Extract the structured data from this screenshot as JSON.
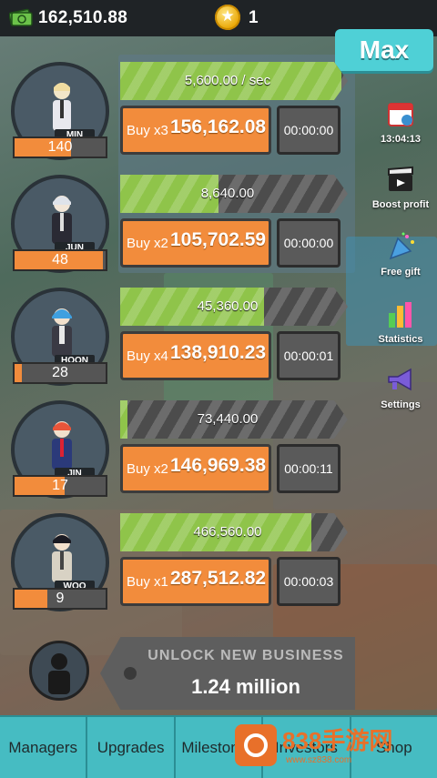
{
  "header": {
    "cash": "162,510.88",
    "coins": "1",
    "max_label": "Max"
  },
  "businesses": [
    {
      "name": "MIN",
      "level": "140",
      "level_fill": 0.62,
      "income": "5,600.00 / sec",
      "progress": 0.97,
      "buy_mult": "Buy x3",
      "buy_cost": "156,162.08",
      "timer": "00:00:00"
    },
    {
      "name": "JUN",
      "level": "48",
      "level_fill": 0.97,
      "income": "8,640.00",
      "progress": 0.43,
      "buy_mult": "Buy x2",
      "buy_cost": "105,702.59",
      "timer": "00:00:00"
    },
    {
      "name": "HOON",
      "level": "28",
      "level_fill": 0.08,
      "income": "45,360.00",
      "progress": 0.63,
      "buy_mult": "Buy x4",
      "buy_cost": "138,910.23",
      "timer": "00:00:01"
    },
    {
      "name": "JIN",
      "level": "17",
      "level_fill": 0.55,
      "income": "73,440.00",
      "progress": 0.03,
      "buy_mult": "Buy x2",
      "buy_cost": "146,969.38",
      "timer": "00:00:11"
    },
    {
      "name": "WOO",
      "level": "9",
      "level_fill": 0.36,
      "income": "466,560.00",
      "progress": 0.84,
      "buy_mult": "Buy x1",
      "buy_cost": "287,512.82",
      "timer": "00:00:03"
    }
  ],
  "side_menu": {
    "timer_value": "13:04:13",
    "boost": "Boost profit",
    "gift": "Free gift",
    "stats": "Statistics",
    "settings": "Settings"
  },
  "unlock": {
    "title": "UNLOCK NEW BUSINESS",
    "amount": "1.24 million"
  },
  "tabs": [
    "Managers",
    "Upgrades",
    "Milestones",
    "Investors",
    "Shop"
  ],
  "watermark": {
    "brand": "838手游网",
    "url": "www.sz838.com"
  },
  "colors": {
    "accent_teal": "#4fd0d6",
    "buy_orange": "#f28c3c",
    "progress_green": "#8fc44a"
  }
}
